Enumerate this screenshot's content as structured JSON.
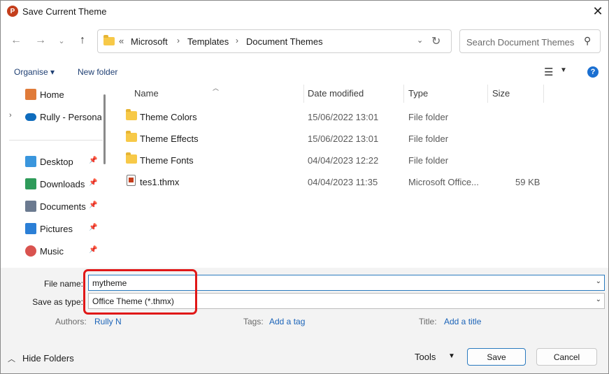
{
  "window": {
    "title": "Save Current Theme",
    "app_icon_letter": "P"
  },
  "nav": {
    "breadcrumb_overflow": "«",
    "crumbs": [
      "Microsoft",
      "Templates",
      "Document Themes"
    ],
    "search_placeholder": "Search Document Themes"
  },
  "commands": {
    "organise": "Organise ▾",
    "new_folder": "New folder"
  },
  "sidebar": {
    "items": [
      {
        "label": "Home",
        "icon": "home-icon",
        "color": "#e07b39"
      },
      {
        "label": "Rully - Persona",
        "icon": "onedrive-icon",
        "color": "#0f6cbd"
      },
      {
        "label": "Desktop",
        "icon": "desktop-icon",
        "color": "#3a96dd"
      },
      {
        "label": "Downloads",
        "icon": "download-icon",
        "color": "#2e9b5a"
      },
      {
        "label": "Documents",
        "icon": "documents-icon",
        "color": "#6b7a90"
      },
      {
        "label": "Pictures",
        "icon": "pictures-icon",
        "color": "#2b7fd6"
      },
      {
        "label": "Music",
        "icon": "music-icon",
        "color": "#d9534f"
      }
    ]
  },
  "columns": {
    "name": "Name",
    "date": "Date modified",
    "type": "Type",
    "size": "Size"
  },
  "files": [
    {
      "name": "Theme Colors",
      "date": "15/06/2022 13:01",
      "type": "File folder",
      "size": "",
      "kind": "folder"
    },
    {
      "name": "Theme Effects",
      "date": "15/06/2022 13:01",
      "type": "File folder",
      "size": "",
      "kind": "folder"
    },
    {
      "name": "Theme Fonts",
      "date": "04/04/2023 12:22",
      "type": "File folder",
      "size": "",
      "kind": "folder"
    },
    {
      "name": "tes1.thmx",
      "date": "04/04/2023 11:35",
      "type": "Microsoft Office...",
      "size": "59 KB",
      "kind": "file"
    }
  ],
  "form": {
    "file_name_label": "File name:",
    "file_name_value": "mytheme",
    "save_type_label": "Save as type:",
    "save_type_value": "Office Theme (*.thmx)",
    "authors_label": "Authors:",
    "authors_value": "Rully N",
    "tags_label": "Tags:",
    "tags_value": "Add a tag",
    "title_label": "Title:",
    "title_value": "Add a title"
  },
  "footer": {
    "hide_folders": "Hide Folders",
    "tools": "Tools",
    "save": "Save",
    "cancel": "Cancel"
  },
  "colors": {
    "accent": "#2a7abf",
    "highlight": "#e01818",
    "link": "#1a63b8"
  }
}
